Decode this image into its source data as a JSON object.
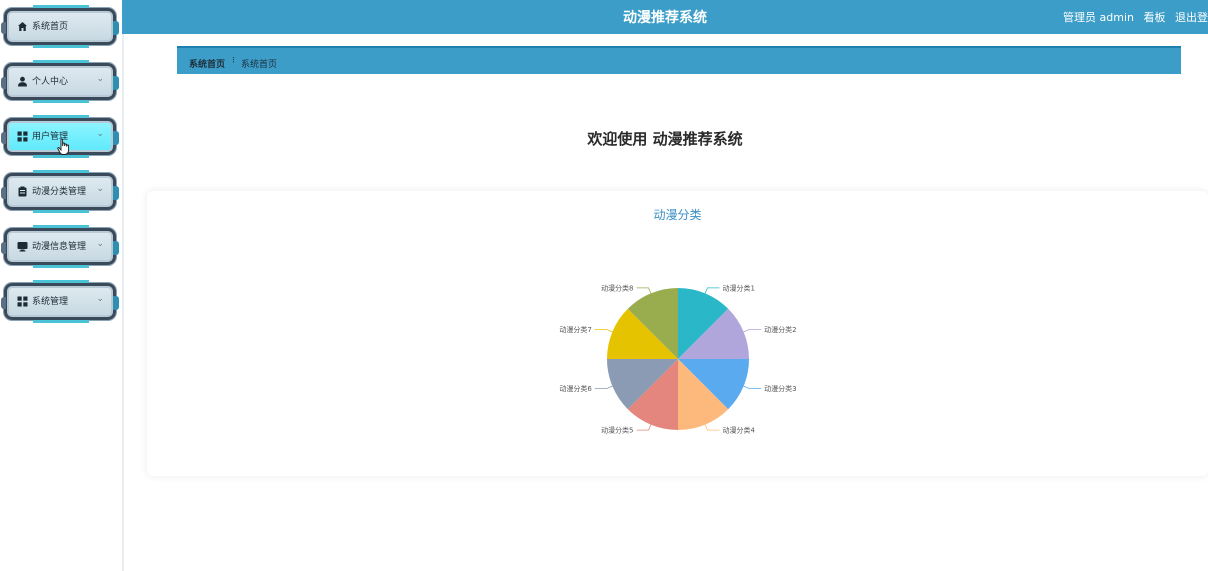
{
  "header": {
    "title": "动漫推荐系统",
    "user_label": "管理员 admin",
    "dashboard_label": "看板",
    "logout_label": "退出登"
  },
  "sidebar": {
    "items": [
      {
        "label": "系统首页",
        "icon": "home-icon",
        "has_chevron": false
      },
      {
        "label": "个人中心",
        "icon": "user-icon",
        "has_chevron": true
      },
      {
        "label": "用户管理",
        "icon": "grid-icon",
        "has_chevron": true
      },
      {
        "label": "动漫分类管理",
        "icon": "clipboard-icon",
        "has_chevron": true
      },
      {
        "label": "动漫信息管理",
        "icon": "monitor-icon",
        "has_chevron": true
      },
      {
        "label": "系统管理",
        "icon": "grid-icon",
        "has_chevron": true
      }
    ],
    "active_index": 2,
    "chevron_glyph": "⌄"
  },
  "breadcrumb": {
    "home": "系统首页",
    "separator": "⁝",
    "current": "系统首页"
  },
  "main": {
    "welcome": "欢迎使用 动漫推荐系统"
  },
  "chart_data": {
    "type": "pie",
    "title": "动漫分类",
    "categories": [
      "动漫分类1",
      "动漫分类2",
      "动漫分类3",
      "动漫分类4",
      "动漫分类5",
      "动漫分类6",
      "动漫分类7",
      "动漫分类8"
    ],
    "values": [
      1,
      1,
      1,
      1,
      1,
      1,
      1,
      1
    ],
    "colors": [
      "#2ab8c9",
      "#b1a6dc",
      "#5aaaf0",
      "#fdb97c",
      "#e4867d",
      "#8b9bb3",
      "#e6c300",
      "#9aad4e"
    ]
  }
}
